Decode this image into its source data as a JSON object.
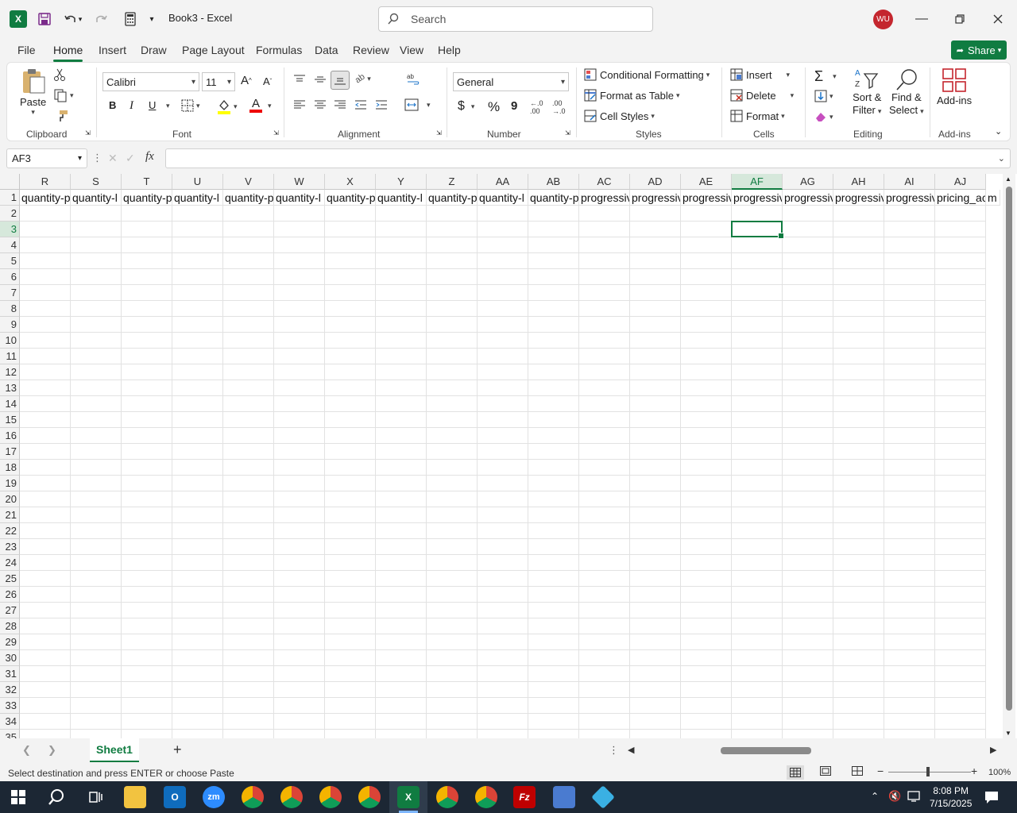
{
  "titlebar": {
    "doc_title": "Book3  -  Excel",
    "search_placeholder": "Search",
    "avatar_initials": "WU",
    "app_logo": "X"
  },
  "menu": {
    "tabs": [
      "File",
      "Home",
      "Insert",
      "Draw",
      "Page Layout",
      "Formulas",
      "Data",
      "Review",
      "View",
      "Help"
    ],
    "active": "Home",
    "share_label": "Share"
  },
  "ribbon": {
    "clipboard": {
      "paste": "Paste",
      "label": "Clipboard"
    },
    "font": {
      "name": "Calibri",
      "size": "11",
      "label": "Font",
      "bold": "B",
      "italic": "I",
      "underline": "U",
      "font_color_letter": "A"
    },
    "alignment": {
      "label": "Alignment"
    },
    "number": {
      "format": "General",
      "label": "Number",
      "currency": "$",
      "percent": "%",
      "comma": "9"
    },
    "styles": {
      "cond_format": "Conditional Formatting",
      "format_table": "Format as Table",
      "cell_styles": "Cell Styles",
      "label": "Styles"
    },
    "cells": {
      "insert": "Insert",
      "delete": "Delete",
      "format": "Format",
      "label": "Cells"
    },
    "editing": {
      "sort_filter_1": "Sort &",
      "sort_filter_2": "Filter",
      "find_select_1": "Find &",
      "find_select_2": "Select",
      "label": "Editing"
    },
    "addins": {
      "button": "Add-ins",
      "label": "Add-ins"
    }
  },
  "formula_bar": {
    "name_box": "AF3",
    "fx": "fx",
    "value": ""
  },
  "grid": {
    "columns": [
      "R",
      "S",
      "T",
      "U",
      "V",
      "W",
      "X",
      "Y",
      "Z",
      "AA",
      "AB",
      "AC",
      "AD",
      "AE",
      "AF",
      "AG",
      "AH",
      "AI",
      "AJ"
    ],
    "selected_column": "AF",
    "selected_row": 3,
    "row_1_values": [
      "quantity-p",
      "quantity-l",
      "quantity-p",
      "quantity-l",
      "quantity-p",
      "quantity-l",
      "quantity-p",
      "quantity-l",
      "quantity-p",
      "quantity-l",
      "quantity-p",
      "progressiv",
      "progressiv",
      "progressiv",
      "progressiv",
      "progressiv",
      "progressiv",
      "progressiv",
      "pricing_ac"
    ],
    "row_1_overflow": "m",
    "rows": [
      "1",
      "2",
      "3",
      "4",
      "5",
      "6",
      "7",
      "8",
      "9",
      "10",
      "11",
      "12",
      "13",
      "14",
      "15",
      "16",
      "17",
      "18",
      "19",
      "20",
      "21",
      "22",
      "23",
      "24",
      "25",
      "26",
      "27",
      "28",
      "29",
      "30",
      "31",
      "32",
      "33",
      "34",
      "35"
    ]
  },
  "sheets": {
    "tabs": [
      "Sheet1"
    ],
    "add": "+"
  },
  "status": {
    "message": "Select destination and press ENTER or choose Paste",
    "zoom": "100%"
  },
  "taskbar": {
    "time": "8:08 PM",
    "date": "7/15/2025"
  },
  "colors": {
    "accent": "#107c41",
    "avatar": "#c4262e"
  }
}
